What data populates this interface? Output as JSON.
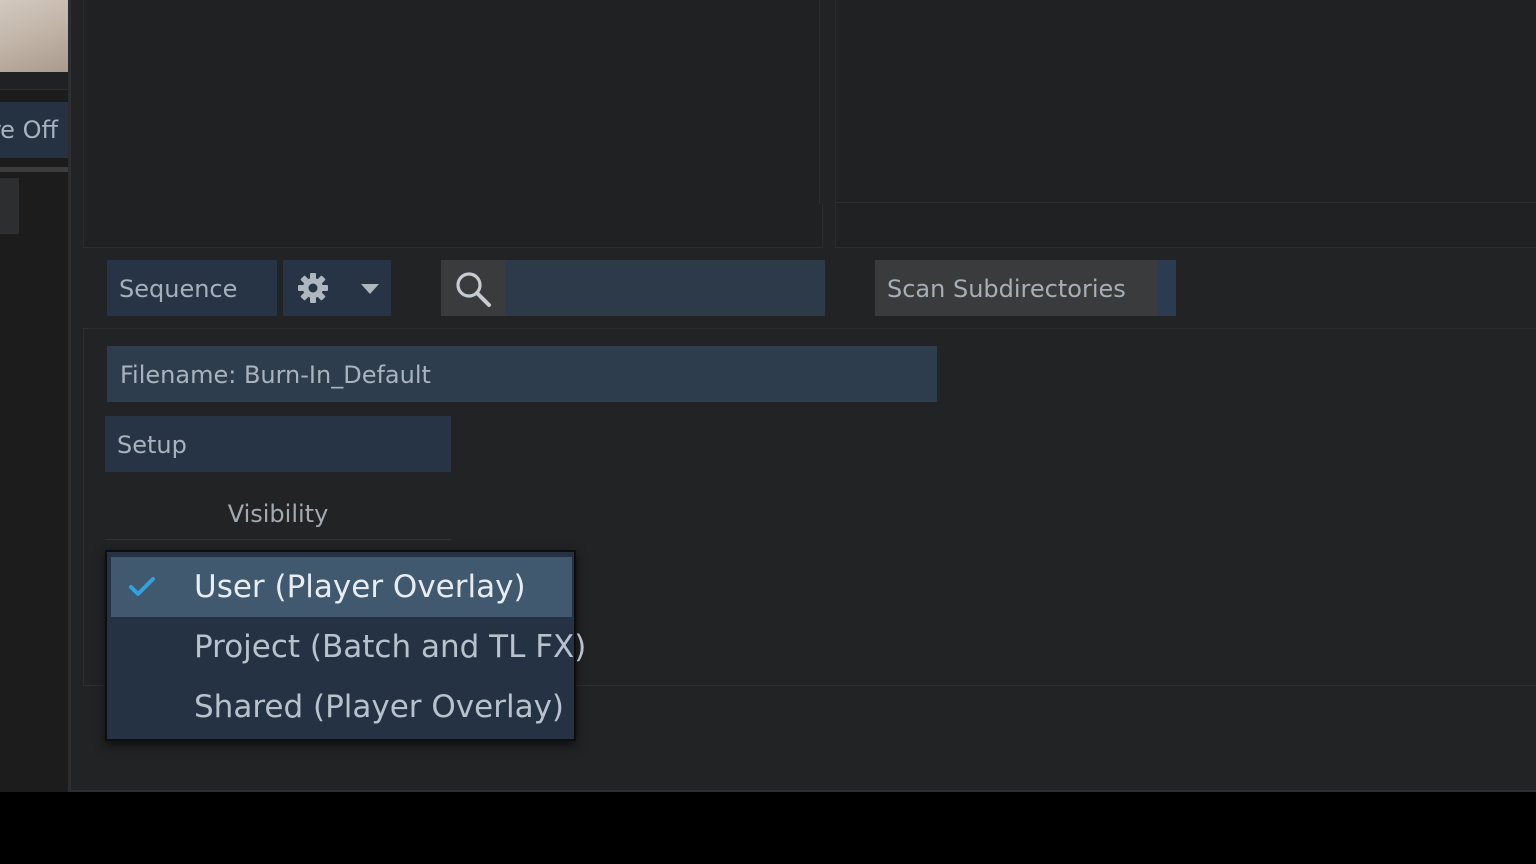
{
  "left_panel": {
    "toggle_label": "re Off"
  },
  "toolbar": {
    "sequence_label": "Sequence",
    "gear_icon": "gear-icon",
    "caret_icon": "chevron-down-icon",
    "search_icon": "search-icon",
    "search_value": "",
    "scan_label": "Scan Subdirectories"
  },
  "settings": {
    "filename": "Filename: Burn-In_Default",
    "setup_label": "Setup",
    "visibility_label": "Visibility"
  },
  "visibility_menu": {
    "items": [
      {
        "label": "User (Player Overlay)",
        "selected": true
      },
      {
        "label": "Project (Batch and TL FX)",
        "selected": false
      },
      {
        "label": "Shared (Player Overlay)",
        "selected": false
      }
    ],
    "check_icon": "check-icon",
    "accent_color": "#2fa3e0"
  },
  "colors": {
    "background": "#222324",
    "button": "#263446",
    "field": "#2e3d4d",
    "menu_selected": "#41596f"
  }
}
